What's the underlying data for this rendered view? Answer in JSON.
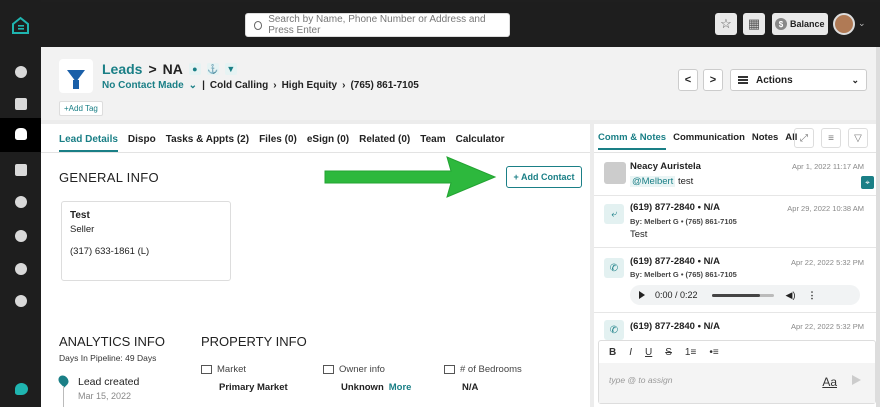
{
  "colors": {
    "accent": "#1a7f86",
    "arrow": "#2db83d",
    "rail": "#1e1e1e"
  },
  "rail": {
    "icons": [
      "home-logo-icon",
      "dashboard-icon",
      "megaphone-icon",
      "hand-leads-icon",
      "house-icon",
      "check-circle-icon",
      "person-icon",
      "download-circle-icon",
      "dollar-circle-icon",
      "chat-bubble-icon"
    ]
  },
  "topbar": {
    "search_placeholder": "Search by Name, Phone Number or Address and Press Enter",
    "balance_label": "Balance",
    "balance_symbol": "$"
  },
  "header": {
    "breadcrumb_root": "Leads",
    "breadcrumb_sep": ">",
    "lead_name": "NA",
    "status": "No Contact Made",
    "status_caret": "⌄",
    "sub_sep": "|",
    "campaign": "Cold Calling",
    "tag": "High Equity",
    "phone": "(765) 861-7105",
    "add_tag": "+Add Tag",
    "prev": "<",
    "next": ">",
    "actions_label": "Actions"
  },
  "tabs": [
    "Lead Details",
    "Dispo",
    "Tasks & Appts (2)",
    "Files (0)",
    "eSign (0)",
    "Related (0)",
    "Team",
    "Calculator"
  ],
  "general": {
    "title": "GENERAL INFO",
    "add_contact": "+ Add Contact",
    "contact": {
      "name": "Test",
      "role": "Seller",
      "phone": "(317) 633-1861",
      "phone_type": "(L)"
    }
  },
  "analytics": {
    "title": "ANALYTICS INFO",
    "pipeline": "Days In Pipeline: 49 Days",
    "event": "Lead created",
    "event_date": "Mar 15, 2022"
  },
  "property": {
    "title": "PROPERTY INFO",
    "fields": [
      {
        "label": "Market",
        "value": "Primary Market",
        "more": ""
      },
      {
        "label": "Owner info",
        "value": "Unknown",
        "more": "More"
      },
      {
        "label": "# of Bedrooms",
        "value": "N/A",
        "more": ""
      }
    ]
  },
  "right": {
    "tabs": [
      "Comm & Notes",
      "Communication",
      "Notes",
      "All"
    ],
    "messages": [
      {
        "title": "Neacy Auristela",
        "time": "Apr 1, 2022 11:17 AM",
        "mention": "@Melbert",
        "body": "test"
      },
      {
        "title": "(619) 877-2840 • N/A",
        "time": "Apr 29, 2022 10:38 AM",
        "by": "By: Melbert G • (765) 861-7105",
        "body": "Test"
      },
      {
        "title": "(619) 877-2840 • N/A",
        "time": "Apr 22, 2022 5:32 PM",
        "by": "By: Melbert G • (765) 861-7105",
        "audio": "0:00 / 0:22",
        "audio_progress": 0.78
      },
      {
        "title": "(619) 877-2840 • N/A",
        "time": "Apr 22, 2022 5:32 PM"
      }
    ],
    "editor": {
      "tools": [
        "B",
        "I",
        "U",
        "S",
        "1≡",
        "•≡"
      ],
      "placeholder": "type @ to assign",
      "format_label": "Aa"
    }
  }
}
